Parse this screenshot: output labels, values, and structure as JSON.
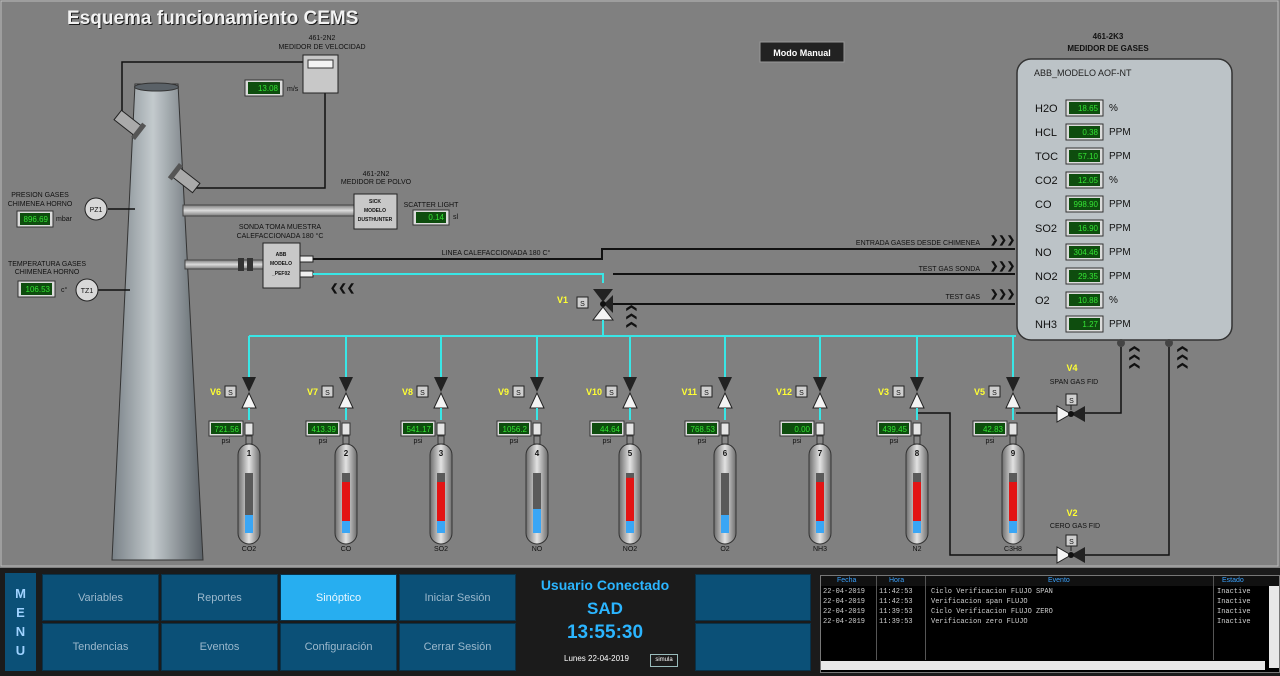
{
  "title": "Esquema funcionamiento CEMS",
  "modo_button": "Modo Manual",
  "velocity_meter": {
    "id": "461-2N2",
    "label": "MEDIDOR DE VELOCIDAD",
    "value": "13.08",
    "unit": "m/s"
  },
  "dust_meter": {
    "id": "461-2N2",
    "label": "MEDIDOR DE POLVO",
    "box_line1": "SICK",
    "box_line2": "MODELO",
    "box_line3": "DUSTHUNTER",
    "scatter_label": "SCATTER LIGHT",
    "scatter_value": "0.14",
    "scatter_unit": "sl"
  },
  "pressure": {
    "label_line1": "PRESION GASES",
    "label_line2": "CHIMENEA HORNO",
    "value": "896.69",
    "unit": "mbar",
    "tag": "PZ1"
  },
  "temperature": {
    "label_line1": "TEMPERATURA GASES",
    "label_line2": "CHIMENEA HORNO",
    "value": "106.53",
    "unit": "c°",
    "tag": "TZ1"
  },
  "probe": {
    "label_line1": "SONDA TOMA MUESTRA",
    "label_line2": "CALEFACCIONADA 180 °C",
    "box_line1": "ABB",
    "box_line2": "MODELO",
    "box_line3": "_PEF02"
  },
  "lines": {
    "heated": "LINEA CALEFACCIONADA 180 C°",
    "entrada": "ENTRADA GASES DESDE CHIMENEA",
    "test_sonda": "TEST GAS SONDA",
    "test_gas": "TEST GAS"
  },
  "analyzer": {
    "id": "461-2K3",
    "title": "MEDIDOR DE GASES",
    "model": "ABB_MODELO AOF-NT",
    "rows": [
      {
        "name": "H2O",
        "value": "18.65",
        "unit": "%"
      },
      {
        "name": "HCL",
        "value": "0.38",
        "unit": "PPM"
      },
      {
        "name": "TOC",
        "value": "57.10",
        "unit": "PPM"
      },
      {
        "name": "CO2",
        "value": "12.05",
        "unit": "%"
      },
      {
        "name": "CO",
        "value": "998.90",
        "unit": "PPM"
      },
      {
        "name": "SO2",
        "value": "16.90",
        "unit": "PPM"
      },
      {
        "name": "NO",
        "value": "304.46",
        "unit": "PPM"
      },
      {
        "name": "NO2",
        "value": "29.35",
        "unit": "PPM"
      },
      {
        "name": "O2",
        "value": "10.88",
        "unit": "%"
      },
      {
        "name": "NH3",
        "value": "1.27",
        "unit": "PPM"
      }
    ]
  },
  "valve_v1": "V1",
  "valve_v4": {
    "label": "V4",
    "caption": "SPAN GAS FID"
  },
  "valve_v2": {
    "label": "V2",
    "caption": "CERO GAS FID"
  },
  "cylinders": [
    {
      "valve": "V6",
      "pressure": "721.56",
      "unit": "psi",
      "number": "1",
      "gas": "CO2",
      "level": 0.3,
      "fill": "blue"
    },
    {
      "valve": "V7",
      "pressure": "413.39",
      "unit": "psi",
      "number": "2",
      "gas": "CO",
      "level": 0.85,
      "fill": "red"
    },
    {
      "valve": "V8",
      "pressure": "541.17",
      "unit": "psi",
      "number": "3",
      "gas": "SO2",
      "level": 0.85,
      "fill": "red"
    },
    {
      "valve": "V9",
      "pressure": "1056.2",
      "unit": "psi",
      "number": "4",
      "gas": "NO",
      "level": 0.4,
      "fill": "blue"
    },
    {
      "valve": "V10",
      "pressure": "44.64",
      "unit": "psi",
      "number": "5",
      "gas": "NO2",
      "level": 0.92,
      "fill": "red"
    },
    {
      "valve": "V11",
      "pressure": "768.53",
      "unit": "psi",
      "number": "6",
      "gas": "O2",
      "level": 0.3,
      "fill": "blue"
    },
    {
      "valve": "V12",
      "pressure": "0.00",
      "unit": "psi",
      "number": "7",
      "gas": "NH3",
      "level": 0.85,
      "fill": "red"
    },
    {
      "valve": "V3",
      "pressure": "439.45",
      "unit": "psi",
      "number": "8",
      "gas": "N2",
      "level": 0.85,
      "fill": "red"
    },
    {
      "valve": "V5",
      "pressure": "42.83",
      "unit": "psi",
      "number": "9",
      "gas": "C3H8",
      "level": 0.85,
      "fill": "red"
    }
  ],
  "footer": {
    "menu_letters": [
      "M",
      "E",
      "N",
      "U"
    ],
    "buttons": {
      "variables": "Variables",
      "reportes": "Reportes",
      "sinoptico": "Sinóptico",
      "iniciar": "Iniciar Sesión",
      "tendencias": "Tendencias",
      "eventos": "Eventos",
      "configuracion": "Configuración",
      "cerrar": "Cerrar Sesión"
    },
    "user_title": "Usuario Conectado",
    "user_name": "SAD",
    "clock": "13:55:30",
    "date": "Lunes 22-04-2019",
    "sim": "simula"
  },
  "events": {
    "headers": {
      "fecha": "Fecha",
      "hora": "Hora",
      "evento": "Evento",
      "estado": "Estado"
    },
    "rows": [
      {
        "fecha": "22-04-2019",
        "hora": "11:42:53",
        "evento": "Ciclo Verificacion FLUJO SPAN",
        "estado": "Inactive"
      },
      {
        "fecha": "22-04-2019",
        "hora": "11:42:53",
        "evento": "Verificacion span FLUJO",
        "estado": "Inactive"
      },
      {
        "fecha": "22-04-2019",
        "hora": "11:39:53",
        "evento": "Ciclo Verificacion FLUJO ZERO",
        "estado": "Inactive"
      },
      {
        "fecha": "22-04-2019",
        "hora": "11:39:53",
        "evento": "Verificacion zero FLUJO",
        "estado": "Inactive"
      }
    ]
  },
  "colors": {
    "background": "#808080",
    "pipe_cyan": "#39e6e6",
    "lcd_green": "#34e534",
    "nav_blue": "#0b5077",
    "nav_active": "#27aef0",
    "gas_red": "#e31414",
    "gas_blue": "#3aa6f5"
  }
}
